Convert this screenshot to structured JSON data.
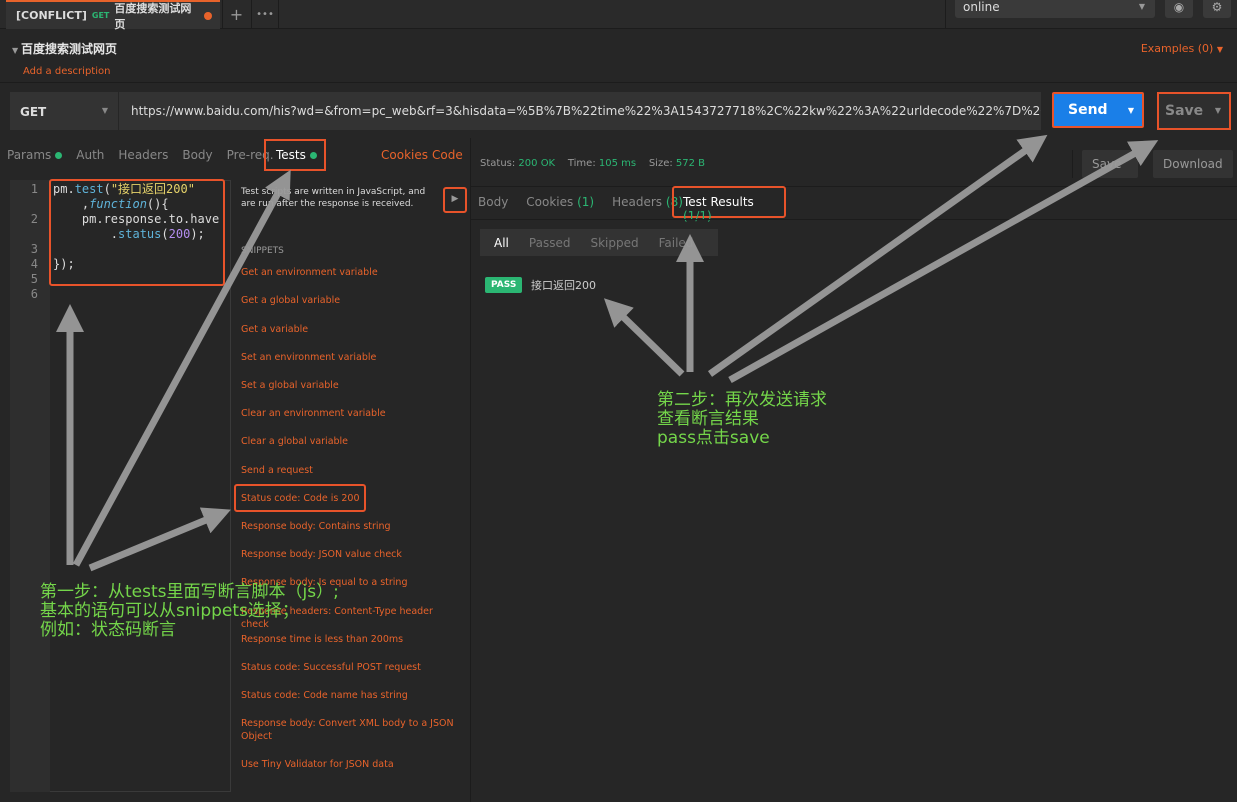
{
  "tab": {
    "conflict": "[CONFLICT]",
    "method": "GET",
    "name": "百度搜索测试网页"
  },
  "topbar": {
    "new_tab": "+",
    "more": "•••",
    "environment": "online"
  },
  "request": {
    "title": "百度搜索测试网页",
    "description": "Add a description",
    "examples": "Examples (0)",
    "method": "GET",
    "url": "https://www.baidu.com/his?wd=&from=pc_web&rf=3&hisdata=%5B%7B%22time%22%3A1543727718%2C%22kw%22%3A%22urldecode%22%7D%2C%7B%22time%22...",
    "send": "Send",
    "save": "Save"
  },
  "left_tabs": [
    "Params",
    "Auth",
    "Headers",
    "Body",
    "Pre-req.",
    "Tests"
  ],
  "links": {
    "cookies": "Cookies",
    "code": "Code"
  },
  "editor": {
    "line_numbers": [
      "1",
      "2",
      "3",
      "4",
      "5",
      "6"
    ]
  },
  "hint": "Test scripts are written in JavaScript, and are run after the response is received.",
  "snippets": {
    "heading": "SNIPPETS",
    "items": [
      "Get an environment variable",
      "Get a global variable",
      "Get a variable",
      "Set an environment variable",
      "Set a global variable",
      "Clear an environment variable",
      "Clear a global variable",
      "Send a request",
      "Status code: Code is 200",
      "Response body: Contains string",
      "Response body: JSON value check",
      "Response body: Is equal to a string",
      "Response headers: Content-Type header check",
      "Response time is less than 200ms",
      "Status code: Successful POST request",
      "Status code: Code name has string",
      "Response body: Convert XML body to a JSON Object",
      "Use Tiny Validator for JSON data"
    ]
  },
  "response": {
    "status_label": "Status:",
    "status": "200 OK",
    "time_label": "Time:",
    "time": "105 ms",
    "size_label": "Size:",
    "size": "572 B",
    "save_btn": "Save",
    "download": "Download",
    "tabs": [
      {
        "label": "Body",
        "count": ""
      },
      {
        "label": "Cookies",
        "count": "(1)"
      },
      {
        "label": "Headers",
        "count": "(8)"
      }
    ],
    "test_results_tab": "Test Results",
    "test_results_count": "(1/1)",
    "filters": [
      "All",
      "Passed",
      "Skipped",
      "Failed"
    ],
    "results": [
      {
        "badge": "PASS",
        "name": "接口返回200"
      }
    ]
  },
  "annotations": {
    "step1": [
      "第一步：从tests里面写断言脚本（js）;",
      "基本的语句可以从snippets选择；",
      "例如：状态码断言"
    ],
    "step2": [
      "第二步：再次发送请求",
      "查看断言结果",
      "pass点击save"
    ]
  },
  "colors": {
    "accent": "#e8632b",
    "highlight_box": "#e8532a",
    "send": "#1a7fe8",
    "pass": "#2bb673",
    "note": "#74d64a"
  }
}
